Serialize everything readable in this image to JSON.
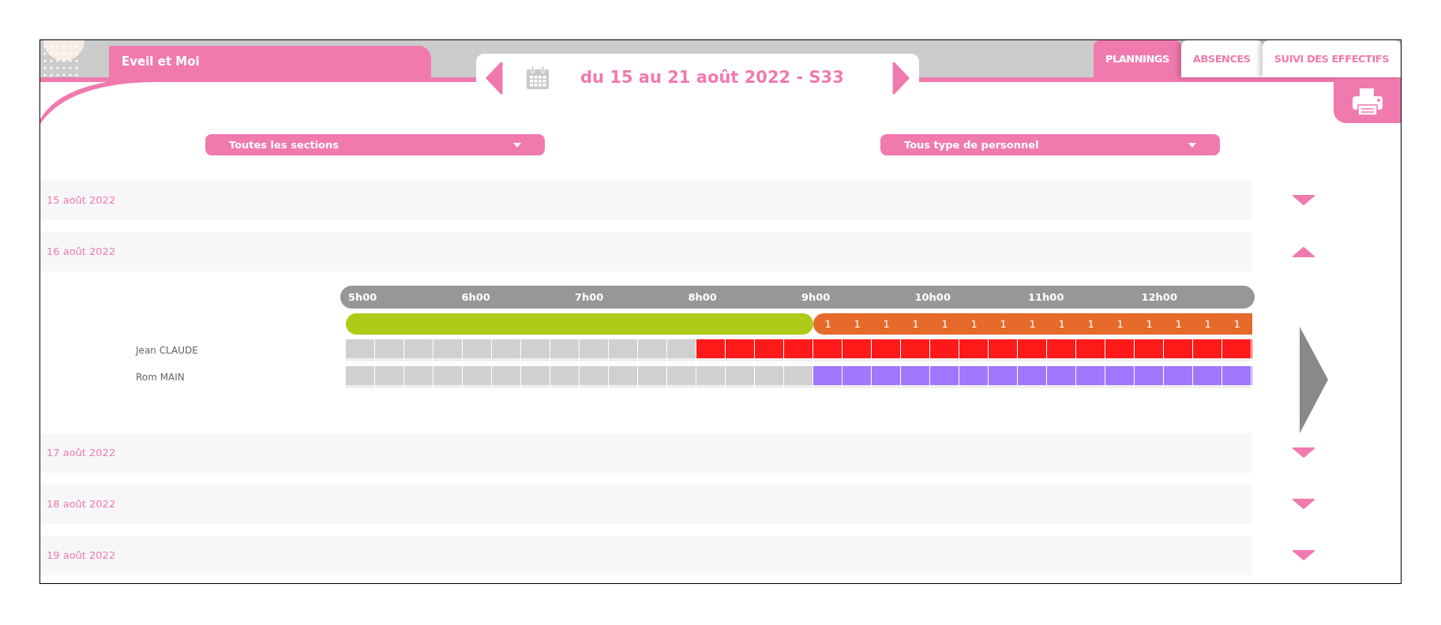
{
  "header": {
    "title": "Eveil et Moi",
    "period": "du 15 au 21 août 2022 - S33"
  },
  "tabs": [
    {
      "label": "PLANNINGS",
      "selected": true
    },
    {
      "label": "ABSENCES",
      "selected": false
    },
    {
      "label": "SUIVI DES EFFECTIFS",
      "selected": false
    }
  ],
  "filters": [
    {
      "label": "Toutes les sections"
    },
    {
      "label": "Tous type de personnel"
    }
  ],
  "days": [
    {
      "label": "15 août 2022",
      "expanded": false
    },
    {
      "label": "16 août 2022",
      "expanded": true
    },
    {
      "label": "17 août 2022",
      "expanded": false
    },
    {
      "label": "18 août 2022",
      "expanded": false
    },
    {
      "label": "19 août 2022",
      "expanded": false
    }
  ],
  "timeline": {
    "hours": [
      "5h00",
      "6h00",
      "7h00",
      "8h00",
      "9h00",
      "10h00",
      "11h00",
      "12h00"
    ],
    "coverage": [
      {
        "color": "#aecb19"
      },
      {
        "color": "#aecb19"
      },
      {
        "color": "#aecb19"
      },
      {
        "color": "#aecb19"
      },
      {
        "color": "#aecb19"
      },
      {
        "color": "#aecb19"
      },
      {
        "color": "#aecb19"
      },
      {
        "color": "#aecb19"
      },
      {
        "color": "#aecb19"
      },
      {
        "color": "#aecb19"
      },
      {
        "color": "#aecb19"
      },
      {
        "color": "#aecb19"
      },
      {
        "color": "#aecb19"
      },
      {
        "color": "#aecb19"
      },
      {
        "color": "#aecb19"
      },
      {
        "color": "#aecb19"
      },
      {
        "color": "#e56a2b",
        "count": "1"
      },
      {
        "color": "#e56a2b",
        "count": "1"
      },
      {
        "color": "#e56a2b",
        "count": "1"
      },
      {
        "color": "#e56a2b",
        "count": "1"
      },
      {
        "color": "#e56a2b",
        "count": "1"
      },
      {
        "color": "#e56a2b",
        "count": "1"
      },
      {
        "color": "#e56a2b",
        "count": "1"
      },
      {
        "color": "#e56a2b",
        "count": "1"
      },
      {
        "color": "#e56a2b",
        "count": "1"
      },
      {
        "color": "#e56a2b",
        "count": "1"
      },
      {
        "color": "#e56a2b",
        "count": "1"
      },
      {
        "color": "#e56a2b",
        "count": "1"
      },
      {
        "color": "#e56a2b",
        "count": "1"
      },
      {
        "color": "#e56a2b",
        "count": "1"
      },
      {
        "color": "#e56a2b",
        "count": "1"
      },
      {
        "color": "#e56a2b"
      }
    ],
    "staff": [
      {
        "name": "Jean CLAUDE",
        "color": "#ff1a1a",
        "slots": [
          {
            "on": false
          },
          {
            "on": false
          },
          {
            "on": false
          },
          {
            "on": false
          },
          {
            "on": false
          },
          {
            "on": false
          },
          {
            "on": false
          },
          {
            "on": false
          },
          {
            "on": false
          },
          {
            "on": false
          },
          {
            "on": false
          },
          {
            "on": false
          },
          {
            "on": true
          },
          {
            "on": true
          },
          {
            "on": true
          },
          {
            "on": true
          },
          {
            "on": true
          },
          {
            "on": true
          },
          {
            "on": true
          },
          {
            "on": true
          },
          {
            "on": true
          },
          {
            "on": true
          },
          {
            "on": true
          },
          {
            "on": true
          },
          {
            "on": true
          },
          {
            "on": true
          },
          {
            "on": true
          },
          {
            "on": true
          },
          {
            "on": true
          },
          {
            "on": true
          },
          {
            "on": true
          },
          {
            "on": true
          }
        ]
      },
      {
        "name": "Rom MAIN",
        "color": "#a077ff",
        "slots": [
          {
            "on": false
          },
          {
            "on": false
          },
          {
            "on": false
          },
          {
            "on": false
          },
          {
            "on": false
          },
          {
            "on": false
          },
          {
            "on": false
          },
          {
            "on": false
          },
          {
            "on": false
          },
          {
            "on": false
          },
          {
            "on": false
          },
          {
            "on": false
          },
          {
            "on": false
          },
          {
            "on": false
          },
          {
            "on": false
          },
          {
            "on": false
          },
          {
            "on": true
          },
          {
            "on": true
          },
          {
            "on": true
          },
          {
            "on": true
          },
          {
            "on": true
          },
          {
            "on": true
          },
          {
            "on": true
          },
          {
            "on": true
          },
          {
            "on": true
          },
          {
            "on": true
          },
          {
            "on": true
          },
          {
            "on": true
          },
          {
            "on": true
          },
          {
            "on": true
          },
          {
            "on": true
          },
          {
            "on": true
          }
        ]
      }
    ]
  }
}
